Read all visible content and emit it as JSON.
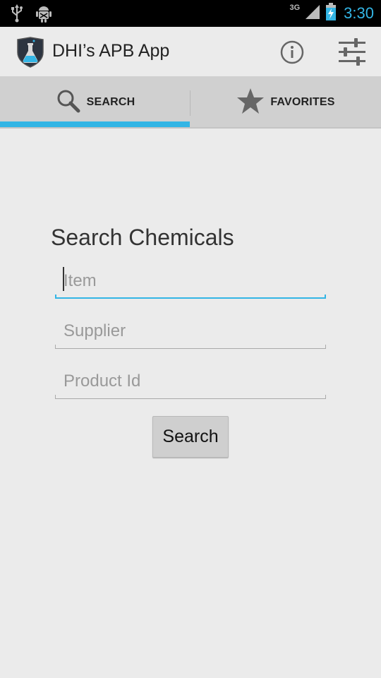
{
  "status_bar": {
    "network_label": "3G",
    "time": "3:30",
    "icons": [
      "usb-icon",
      "android-debug-icon",
      "signal-icon",
      "battery-charging-icon"
    ]
  },
  "action_bar": {
    "title": "DHI’s APB App",
    "logo_icon": "shield-flask-icon",
    "actions": [
      "info-icon",
      "settings-sliders-icon"
    ]
  },
  "tabs": [
    {
      "label": "SEARCH",
      "icon": "search-icon",
      "selected": true
    },
    {
      "label": "FAVORITES",
      "icon": "star-icon",
      "selected": false
    }
  ],
  "form": {
    "title": "Search Chemicals",
    "fields": [
      {
        "placeholder": "Item",
        "value": ""
      },
      {
        "placeholder": "Supplier",
        "value": ""
      },
      {
        "placeholder": "Product Id",
        "value": ""
      }
    ],
    "button_label": "Search"
  },
  "colors": {
    "accent": "#33b5e5",
    "background": "#ebebeb",
    "tab_bar": "#d0d0d0"
  }
}
